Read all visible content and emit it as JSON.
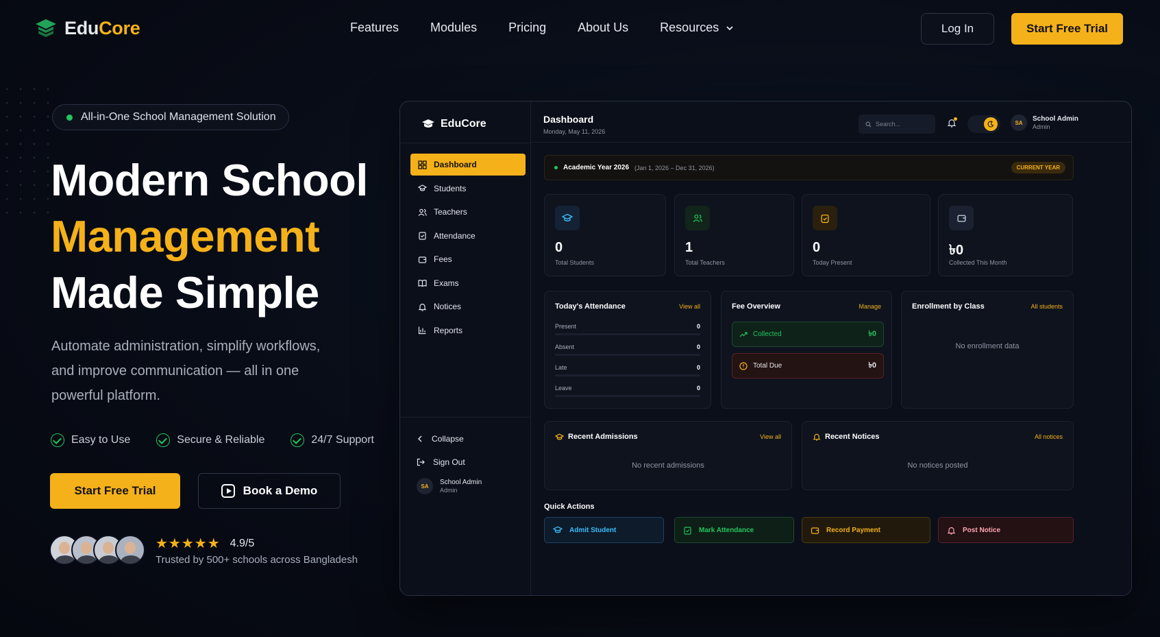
{
  "brand": {
    "name_a": "Edu",
    "name_b": "Core",
    "full": "EduCore",
    "accent": "#f5b11a"
  },
  "nav": {
    "links": [
      "Features",
      "Modules",
      "Pricing",
      "About Us",
      "Resources"
    ],
    "login": "Log In",
    "cta": "Start Free Trial"
  },
  "hero": {
    "pill": "All-in-One School Management Solution",
    "title_line1": "Modern School",
    "title_line2": "Management",
    "title_line3": "Made Simple",
    "subtitle": "Automate administration, simplify workflows, and improve communication — all in one powerful platform.",
    "features": [
      "Easy to Use",
      "Secure & Reliable",
      "24/7 Support"
    ],
    "cta_primary": "Start Free Trial",
    "cta_secondary": "Book a Demo",
    "stars": "★★★★★",
    "rating": "4.9/5",
    "trusted": "Trusted by 500+ schools across Bangladesh"
  },
  "dashboard": {
    "sidebar": {
      "logo": "EduCore",
      "items": [
        "Dashboard",
        "Students",
        "Teachers",
        "Attendance",
        "Fees",
        "Exams",
        "Notices",
        "Reports"
      ],
      "collapse": "Collapse",
      "signout": "Sign Out",
      "user_initials": "SA",
      "user_name": "School Admin",
      "user_role": "Admin"
    },
    "topbar": {
      "title": "Dashboard",
      "date": "Monday, May 11, 2026",
      "search_placeholder": "Search...",
      "user_initials": "SA",
      "user_name": "School Admin",
      "user_role": "Admin"
    },
    "academic_year": {
      "title": "Academic Year 2026",
      "range": "(Jan 1, 2026 – Dec 31, 2026)",
      "badge": "CURRENT YEAR"
    },
    "stats": [
      {
        "value": "0",
        "label": "Total Students",
        "icon": "graduation-cap-icon",
        "color": "#38bdf8"
      },
      {
        "value": "1",
        "label": "Total Teachers",
        "icon": "users-icon",
        "color": "#22c55e"
      },
      {
        "value": "0",
        "label": "Today Present",
        "icon": "clipboard-check-icon",
        "color": "#f5b11a"
      },
      {
        "value": "৳0",
        "label": "Collected This Month",
        "icon": "wallet-icon",
        "color": "#cbd5e1"
      }
    ],
    "attendance": {
      "title": "Today's Attendance",
      "link": "View all",
      "rows": [
        {
          "label": "Present",
          "value": "0"
        },
        {
          "label": "Absent",
          "value": "0"
        },
        {
          "label": "Late",
          "value": "0"
        },
        {
          "label": "Leave",
          "value": "0"
        }
      ]
    },
    "fees": {
      "title": "Fee Overview",
      "link": "Manage",
      "collected_label": "Collected",
      "collected_value": "৳0",
      "due_label": "Total Due",
      "due_value": "৳0"
    },
    "enrollment": {
      "title": "Enrollment by Class",
      "link": "All students",
      "empty": "No enrollment data"
    },
    "admissions": {
      "title": "Recent Admissions",
      "link": "View all",
      "empty": "No recent admissions"
    },
    "notices": {
      "title": "Recent Notices",
      "link": "All notices",
      "empty": "No notices posted"
    },
    "quick_actions": {
      "title": "Quick Actions",
      "items": [
        "Admit Student",
        "Mark Attendance",
        "Record Payment",
        "Post Notice"
      ]
    }
  }
}
